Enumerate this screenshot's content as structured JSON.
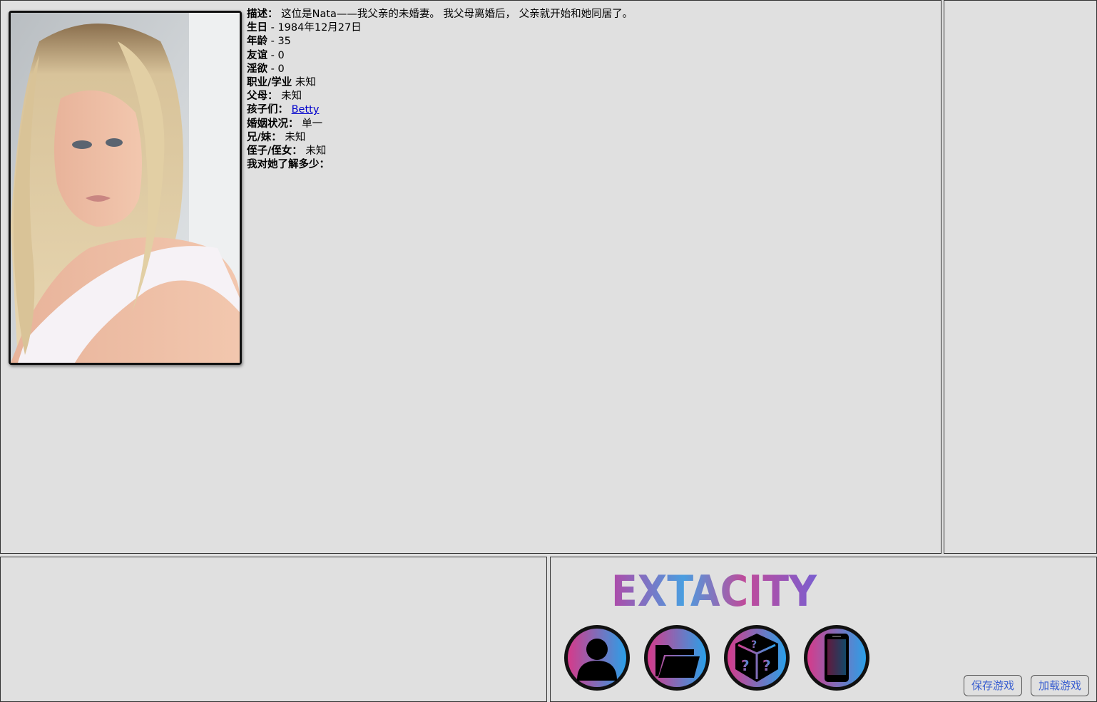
{
  "profile": {
    "portrait_icon": "woman-portrait-photo",
    "rows": [
      {
        "key": "描述：",
        "value": " 这位是Nata——我父亲的未婚妻。 我父母离婚后， 父亲就开始和她同居了。"
      },
      {
        "key": "生日",
        "value": " - 1984年12月27日"
      },
      {
        "key": "年龄",
        "value": " - 35"
      },
      {
        "key": "友谊",
        "value": " - 0"
      },
      {
        "key": "淫欲",
        "value": " - 0"
      },
      {
        "key": "职业/学业",
        "value": " 未知"
      },
      {
        "key": "父母：",
        "value": " 未知"
      },
      {
        "key": "孩子们：",
        "value": " ",
        "link": "Betty"
      },
      {
        "key": "婚姻状况：",
        "value": " 单一"
      },
      {
        "key": "兄/妹：",
        "value": " 未知"
      },
      {
        "key": "侄子/侄女：",
        "value": " 未知"
      },
      {
        "key": "我对她了解多少：",
        "value": ""
      }
    ]
  },
  "logo": {
    "text": "EXTACITY",
    "gradient": [
      "#8a4fc0",
      "#3aa8e0",
      "#c04aa0",
      "#6a5fd0"
    ]
  },
  "nav": [
    {
      "name": "character-button",
      "icon": "person-icon"
    },
    {
      "name": "inventory-button",
      "icon": "folder-icon"
    },
    {
      "name": "random-button",
      "icon": "question-dice-icon"
    },
    {
      "name": "phone-button",
      "icon": "phone-icon"
    }
  ],
  "buttons": {
    "save": "保存游戏",
    "load": "加载游戏"
  },
  "colors": {
    "panel_bg": "#e0e0e0",
    "border": "#333333",
    "link": "#0000cc",
    "button_text": "#3a5fd0",
    "accent_pink": "#d63a8a",
    "accent_blue": "#2aa0e8"
  }
}
